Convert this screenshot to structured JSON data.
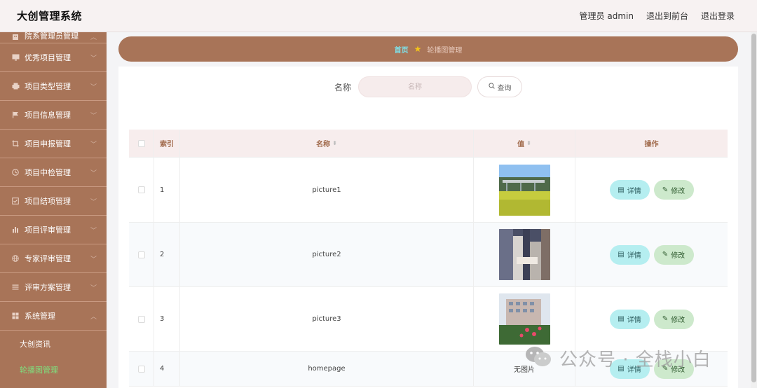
{
  "app": {
    "title": "大创管理系统"
  },
  "header": {
    "user_label": "管理员 admin",
    "frontend_label": "退出到前台",
    "logout_label": "退出登录"
  },
  "sidebar": {
    "items": [
      {
        "label": "院系管理员管理",
        "icon": "building-icon"
      },
      {
        "label": "优秀项目管理",
        "icon": "monitor-icon"
      },
      {
        "label": "项目类型管理",
        "icon": "printer-icon"
      },
      {
        "label": "项目信息管理",
        "icon": "flag-icon"
      },
      {
        "label": "项目申报管理",
        "icon": "crop-icon"
      },
      {
        "label": "项目中检管理",
        "icon": "clock-icon"
      },
      {
        "label": "项目结项管理",
        "icon": "check-square-icon"
      },
      {
        "label": "项目评审管理",
        "icon": "bar-chart-icon"
      },
      {
        "label": "专家评审管理",
        "icon": "globe-icon"
      },
      {
        "label": "评审方案管理",
        "icon": "list-icon"
      },
      {
        "label": "系统管理",
        "icon": "grid-icon"
      }
    ],
    "subitems": [
      {
        "label": "大创资讯",
        "active": false
      },
      {
        "label": "轮播图管理",
        "active": true
      }
    ]
  },
  "breadcrumb": {
    "home": "首页",
    "current": "轮播图管理"
  },
  "search": {
    "label": "名称",
    "placeholder": "名称",
    "button": "查询"
  },
  "table": {
    "headers": {
      "index": "索引",
      "name": "名称",
      "value": "值",
      "actions": "操作"
    },
    "rows": [
      {
        "index": "1",
        "name": "picture1",
        "value_image": "picture-landscape",
        "value_text": ""
      },
      {
        "index": "2",
        "name": "picture2",
        "value_image": "picture-abstract",
        "value_text": ""
      },
      {
        "index": "3",
        "name": "picture3",
        "value_image": "picture-building",
        "value_text": ""
      },
      {
        "index": "4",
        "name": "homepage",
        "value_image": "",
        "value_text": "无图片"
      }
    ],
    "detail_label": "详情",
    "edit_label": "修改"
  },
  "watermark": {
    "text": "公众号 · 全栈小白"
  },
  "colors": {
    "sidebar": "#a87458",
    "accent_cyan": "#b5eef0",
    "accent_green": "#cde9cc",
    "active_sub": "#7ee07e"
  }
}
